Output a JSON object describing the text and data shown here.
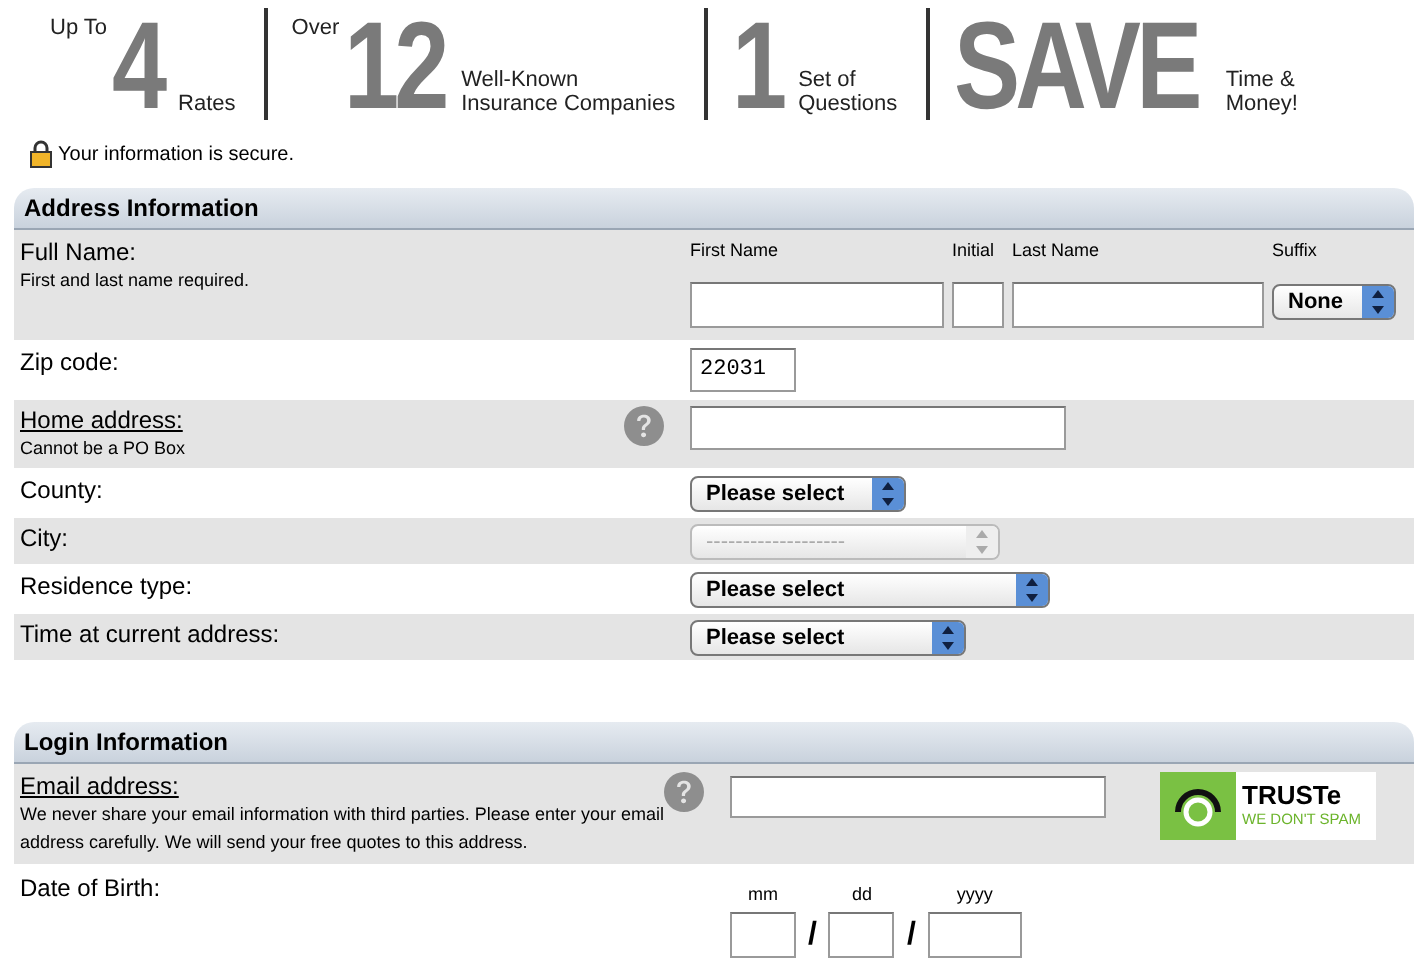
{
  "header": {
    "stats": [
      {
        "pre": "Up To",
        "big": "4",
        "post": [
          "Rates"
        ]
      },
      {
        "pre": "Over",
        "big": "12",
        "post": [
          "Well-Known",
          "Insurance Companies"
        ]
      },
      {
        "big": "1",
        "post": [
          "Set of",
          "Questions"
        ]
      },
      {
        "big": "SAVE",
        "post": [
          "Time &",
          "Money!"
        ]
      }
    ],
    "secure": "Your information is secure."
  },
  "sections": [
    {
      "title": "Address Information",
      "rows": [
        {
          "kind": "name",
          "label": "Full Name:",
          "hint": "First and last name required.",
          "columns": [
            {
              "kind": "input",
              "label": "First Name"
            },
            {
              "kind": "input",
              "label": "Initial"
            },
            {
              "kind": "input",
              "label": "Last Name"
            },
            {
              "kind": "select",
              "label": "Suffix",
              "value": "None"
            }
          ]
        },
        {
          "kind": "input",
          "label": "Zip code:",
          "value": "22031"
        },
        {
          "kind": "input",
          "label": "Home address:",
          "link": true,
          "hint": "Cannot be a PO Box",
          "help": true
        },
        {
          "kind": "select",
          "label": "County:",
          "value": "Please select",
          "disabled": false
        },
        {
          "kind": "select",
          "label": "City:",
          "value": "-------------------",
          "disabled": true
        },
        {
          "kind": "select",
          "label": "Residence type:",
          "value": "Please select",
          "disabled": false
        },
        {
          "kind": "select",
          "label": "Time at current address:",
          "value": "Please select",
          "disabled": false
        }
      ]
    },
    {
      "title": "Login Information",
      "rows": [
        {
          "kind": "email",
          "label": "Email address:",
          "link": true,
          "hint": "We never share your email information with third parties. Please enter your email address carefully. We will send your free quotes to this address.",
          "help": true,
          "seal": {
            "name": "TRUSTe",
            "tagline": "WE DON'T SPAM"
          }
        },
        {
          "kind": "date",
          "label": "Date of Birth:",
          "parts": [
            {
              "label": "mm"
            },
            {
              "label": "dd"
            },
            {
              "label": "yyyy"
            }
          ],
          "separators": [
            "/",
            "/"
          ]
        }
      ]
    }
  ]
}
